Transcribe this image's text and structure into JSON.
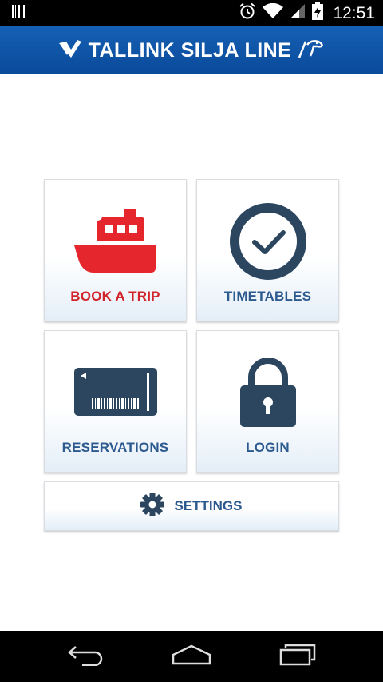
{
  "status_bar": {
    "time": "12:51",
    "icons": [
      "barcode-notification-icon",
      "alarm-icon",
      "wifi-icon",
      "cell-signal-icon",
      "battery-charging-icon"
    ]
  },
  "header": {
    "brand_name": "TALLINK SILJA LINE",
    "logo_icon": "tallink-logo-icon",
    "secondary_logo_icon": "seal-logo-icon",
    "background_color": "#0a4a9a"
  },
  "tiles": {
    "book_trip": {
      "label": "BOOK A TRIP",
      "icon": "ship-icon",
      "color": "#d1242a"
    },
    "timetables": {
      "label": "TIMETABLES",
      "icon": "clock-check-icon",
      "color": "#2d5a8e"
    },
    "reservations": {
      "label": "RESERVATIONS",
      "icon": "ticket-card-icon",
      "color": "#2d5a8e"
    },
    "login": {
      "label": "LOGIN",
      "icon": "padlock-icon",
      "color": "#2d5a8e"
    },
    "settings": {
      "label": "SETTINGS",
      "icon": "gear-icon",
      "color": "#2d5a8e"
    }
  },
  "nav_bar": {
    "buttons": [
      "back-icon",
      "home-icon",
      "recent-apps-icon"
    ]
  }
}
